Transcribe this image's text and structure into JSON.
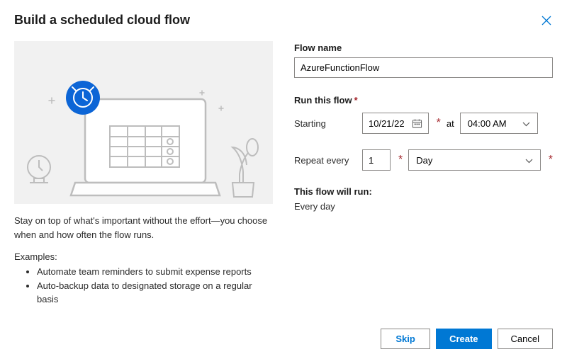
{
  "header": {
    "title": "Build a scheduled cloud flow"
  },
  "left": {
    "description": "Stay on top of what's important without the effort—you choose when and how often the flow runs.",
    "examplesLabel": "Examples:",
    "examples": [
      "Automate team reminders to submit expense reports",
      "Auto-backup data to designated storage on a regular basis"
    ]
  },
  "form": {
    "flowNameLabel": "Flow name",
    "flowNameValue": "AzureFunctionFlow",
    "runSectionLabel": "Run this flow",
    "startingLabel": "Starting",
    "startingDate": "10/21/22",
    "atLabel": "at",
    "startingTime": "04:00 AM",
    "repeatLabel": "Repeat every",
    "repeatValue": "1",
    "repeatUnit": "Day",
    "summaryLabel": "This flow will run:",
    "summaryValue": "Every day"
  },
  "footer": {
    "skip": "Skip",
    "create": "Create",
    "cancel": "Cancel"
  }
}
